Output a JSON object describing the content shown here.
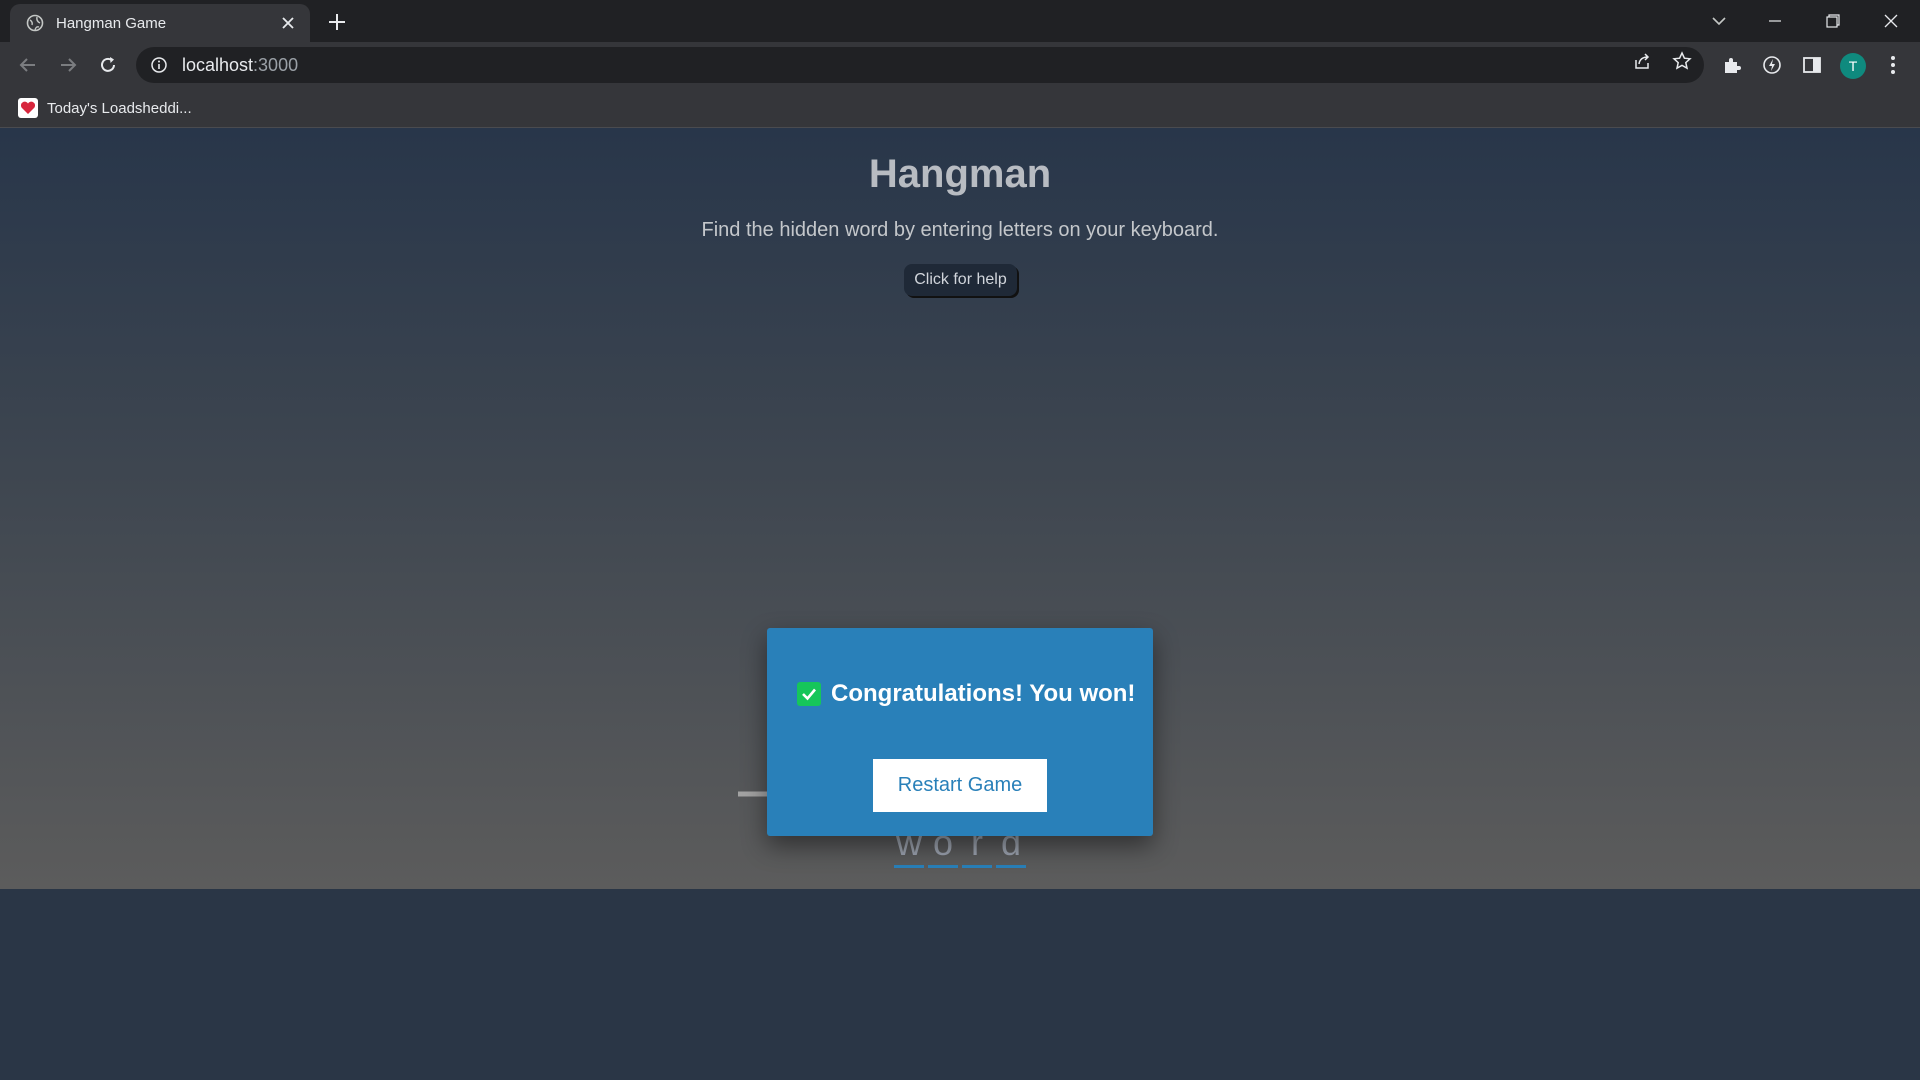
{
  "browser": {
    "tab_title": "Hangman Game",
    "url_host": "localhost",
    "url_port": ":3000",
    "profile_initial": "T",
    "bookmark_label": "Today's Loadsheddi..."
  },
  "page": {
    "title": "Hangman",
    "subtitle": "Find the hidden word by entering letters on your keyboard.",
    "help_label": "Click for help"
  },
  "word": {
    "letters": [
      "w",
      "o",
      "r",
      "d"
    ]
  },
  "modal": {
    "message": "Congratulations! You won!",
    "restart_label": "Restart Game"
  },
  "colors": {
    "accent": "#2980b9",
    "success": "#16c65a",
    "text_muted": "#b8bcc2"
  }
}
